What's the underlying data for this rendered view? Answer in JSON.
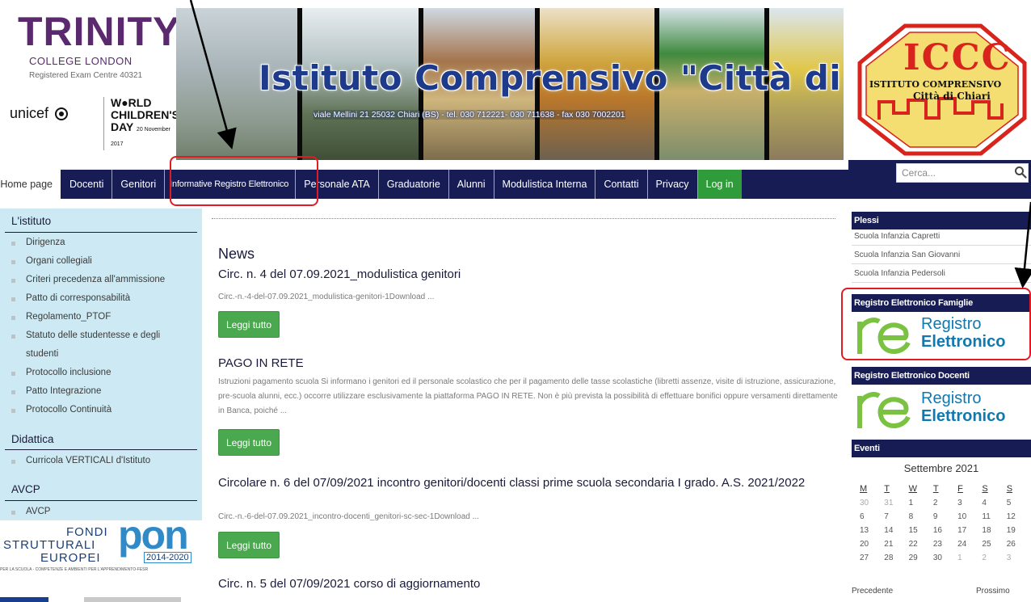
{
  "header": {
    "title": "Istituto Comprensivo \"Città di Chiari\"",
    "contact": "viale Mellini 21 25032 Chiari (BS) - tel. 030 712221- 030 711638 - fax 030 7002201",
    "trinity": {
      "name": "TRINITY",
      "sub": "COLLEGE LONDON",
      "exam_centre": "Registered Exam Centre 40321"
    },
    "unicef": {
      "name": "unicef",
      "wcd_line1": "W●RLD",
      "wcd_line2": "CHILDREN'S",
      "wcd_line3": "DAY",
      "wcd_date": "20 November 2017"
    },
    "iccc": {
      "acronym": "ICCC",
      "line1": "ISTITUTO COMPRENSIVO",
      "line2": "Città di Chiari"
    }
  },
  "nav": {
    "items": [
      {
        "label": "Home page"
      },
      {
        "label": "Docenti"
      },
      {
        "label": "Genitori"
      },
      {
        "label": "Informative Registro Elettronico"
      },
      {
        "label": "Personale ATA"
      },
      {
        "label": "Graduatorie"
      },
      {
        "label": "Alunni"
      },
      {
        "label": "Modulistica Interna"
      },
      {
        "label": "Contatti"
      },
      {
        "label": "Privacy"
      },
      {
        "label": "Log in"
      }
    ],
    "search_placeholder": "Cerca..."
  },
  "sidebar": {
    "istituto": {
      "heading": "L'istituto",
      "items": [
        "Dirigenza",
        "Organi collegiali",
        "Criteri precedenza all'ammissione",
        "Patto di corresponsabilità",
        "Regolamento_PTOF",
        "Statuto delle studentesse e degli",
        "studenti",
        "Protocollo inclusione",
        "Patto Integrazione",
        "Protocollo Continuità"
      ]
    },
    "didattica": {
      "heading": "Didattica",
      "items": [
        "Curricola VERTICALI d'Istituto"
      ]
    },
    "avcp": {
      "heading": "AVCP",
      "items": [
        "AVCP"
      ]
    },
    "pon": {
      "fondi": "FONDI",
      "strutturali": "STRUTTURALI",
      "europei": "EUROPEI",
      "pon": "PON",
      "years": "2014-2020",
      "tagline": "PER LA SCUOLA - COMPETENZE E AMBIENTI PER L'APPRENDIMENTO-FESR"
    }
  },
  "main": {
    "heading": "News",
    "read_more": "Leggi tutto",
    "posts": [
      {
        "title": "Circ. n. 4 del 07.09.2021_modulistica genitori",
        "excerpt": "Circ.-n.-4-del-07.09.2021_modulistica-genitori-1Download ..."
      },
      {
        "title": "PAGO IN RETE",
        "excerpt": "Istruzioni pagamento scuola Si informano i genitori ed il personale scolastico che per il pagamento delle tasse scolastiche (libretti assenze, visite di istruzione, assicurazione, pre-scuola alunni, ecc.) occorre utilizzare esclusivamente la piattaforma PAGO IN RETE. Non è più prevista la possibilità di effettuare bonifici oppure versamenti direttamente in Banca, poiché ..."
      },
      {
        "title": "Circolare n. 6 del 07/09/2021 incontro genitori/docenti classi prime scuola secondaria I grado. A.S. 2021/2022",
        "excerpt": "Circ.-n.-6-del-07.09.2021_incontro-docenti_genitori-sc-sec-1Download ..."
      },
      {
        "title": "Circ. n. 5 del 07/09/2021 corso di aggiornamento",
        "excerpt": ""
      }
    ]
  },
  "right": {
    "plessi": {
      "heading": "Plessi",
      "items": [
        "Scuola Infanzia Capretti",
        "Scuola Infanzia San Giovanni",
        "Scuola Infanzia Pedersoli"
      ]
    },
    "re_famiglie": {
      "heading": "Registro Elettronico Famiglie",
      "word1": "Registro",
      "word2": "Elettronico"
    },
    "re_docenti": {
      "heading": "Registro Elettronico Docenti",
      "word1": "Registro",
      "word2": "Elettronico"
    },
    "eventi": {
      "heading": "Eventi",
      "month": "Settembre 2021",
      "weekdays": [
        "M",
        "T",
        "W",
        "T",
        "F",
        "S",
        "S"
      ],
      "weeks": [
        [
          "30",
          "31",
          "1",
          "2",
          "3",
          "4",
          "5"
        ],
        [
          "6",
          "7",
          "8",
          "9",
          "10",
          "11",
          "12"
        ],
        [
          "13",
          "14",
          "15",
          "16",
          "17",
          "18",
          "19"
        ],
        [
          "20",
          "21",
          "22",
          "23",
          "24",
          "25",
          "26"
        ],
        [
          "27",
          "28",
          "29",
          "30",
          "1",
          "2",
          "3"
        ]
      ],
      "prev": "Precedente",
      "next": "Prossimo"
    }
  },
  "colors": {
    "nav": "#171c54",
    "login": "#2f9b3a",
    "sidebar": "#cdeaf4",
    "button": "#4aa84e",
    "annotation": "#e01b24"
  },
  "icons": {
    "search": "search-icon"
  }
}
